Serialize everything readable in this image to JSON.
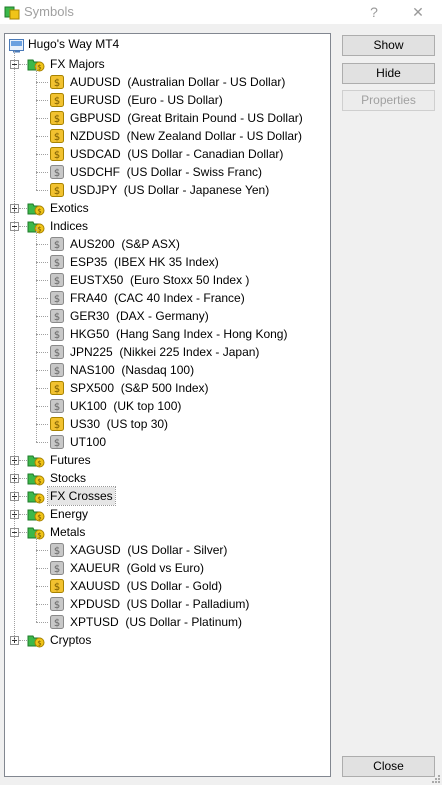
{
  "window": {
    "title": "Symbols",
    "help_glyph": "?",
    "close_glyph": "✕"
  },
  "buttons": {
    "show": "Show",
    "hide": "Hide",
    "properties": "Properties",
    "close": "Close"
  },
  "tree": {
    "root": "Hugo's Way MT4",
    "groups": [
      {
        "label": "FX Majors",
        "expanded": true,
        "items": [
          {
            "label": "AUDUSD  (Australian Dollar - US Dollar)",
            "active": true
          },
          {
            "label": "EURUSD  (Euro - US Dollar)",
            "active": true
          },
          {
            "label": "GBPUSD  (Great Britain Pound - US Dollar)",
            "active": true
          },
          {
            "label": "NZDUSD  (New Zealand Dollar - US Dollar)",
            "active": true
          },
          {
            "label": "USDCAD  (US Dollar - Canadian Dollar)",
            "active": true
          },
          {
            "label": "USDCHF  (US Dollar - Swiss Franc)",
            "active": false
          },
          {
            "label": "USDJPY  (US Dollar - Japanese Yen)",
            "active": true
          }
        ]
      },
      {
        "label": "Exotics",
        "expanded": false,
        "items": []
      },
      {
        "label": "Indices",
        "expanded": true,
        "items": [
          {
            "label": "AUS200  (S&P ASX)",
            "active": false
          },
          {
            "label": "ESP35  (IBEX HK 35 Index)",
            "active": false
          },
          {
            "label": "EUSTX50  (Euro Stoxx 50 Index )",
            "active": false
          },
          {
            "label": "FRA40  (CAC 40 Index - France)",
            "active": false
          },
          {
            "label": "GER30  (DAX - Germany)",
            "active": false
          },
          {
            "label": "HKG50  (Hang Sang Index - Hong Kong)",
            "active": false
          },
          {
            "label": "JPN225  (Nikkei 225 Index - Japan)",
            "active": false
          },
          {
            "label": "NAS100  (Nasdaq 100)",
            "active": false
          },
          {
            "label": "SPX500  (S&P 500 Index)",
            "active": true
          },
          {
            "label": "UK100  (UK top 100)",
            "active": false
          },
          {
            "label": "US30  (US top 30)",
            "active": true
          },
          {
            "label": "UT100",
            "active": false
          }
        ]
      },
      {
        "label": "Futures",
        "expanded": false,
        "items": []
      },
      {
        "label": "Stocks",
        "expanded": false,
        "items": []
      },
      {
        "label": "FX Crosses",
        "expanded": false,
        "selected": true,
        "items": []
      },
      {
        "label": "Energy",
        "expanded": false,
        "items": []
      },
      {
        "label": "Metals",
        "expanded": true,
        "items": [
          {
            "label": "XAGUSD  (US Dollar - Silver)",
            "active": false
          },
          {
            "label": "XAUEUR  (Gold vs Euro)",
            "active": false
          },
          {
            "label": "XAUUSD  (US Dollar - Gold)",
            "active": true
          },
          {
            "label": "XPDUSD  (US Dollar - Palladium)",
            "active": false
          },
          {
            "label": "XPTUSD  (US Dollar - Platinum)",
            "active": false
          }
        ]
      },
      {
        "label": "Cryptos",
        "expanded": false,
        "items": []
      }
    ]
  },
  "colors": {
    "active_coin": "#f2c230",
    "inactive_coin": "#c8c8c8",
    "folder_green": "#3cb84a",
    "folder_yellow": "#f0c419"
  }
}
